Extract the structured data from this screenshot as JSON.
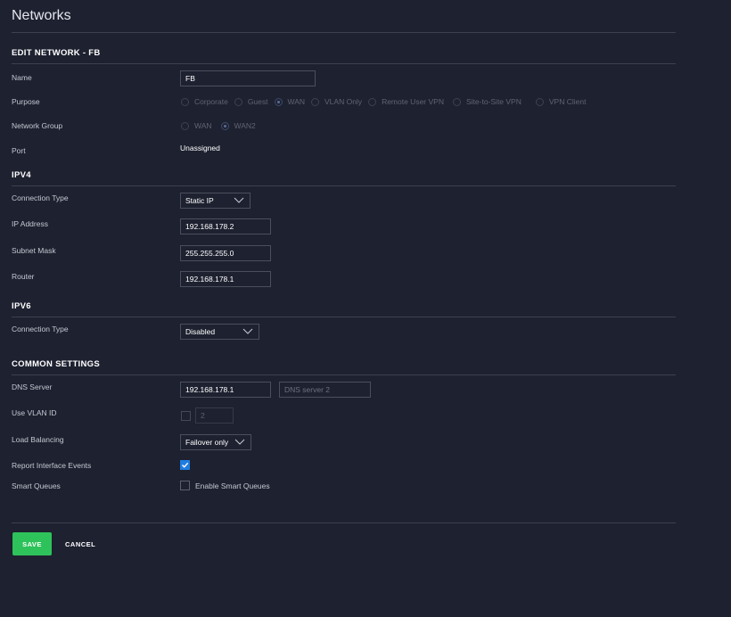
{
  "page": {
    "title": "Networks"
  },
  "edit": {
    "heading": "EDIT NETWORK - FB",
    "name_label": "Name",
    "name_value": "FB",
    "purpose_label": "Purpose",
    "purpose_options": [
      "Corporate",
      "Guest",
      "WAN",
      "VLAN Only",
      "Remote User VPN",
      "Site-to-Site VPN",
      "VPN Client"
    ],
    "purpose_selected": "WAN",
    "network_group_label": "Network Group",
    "network_group_options": [
      "WAN",
      "WAN2"
    ],
    "network_group_selected": "WAN2",
    "port_label": "Port",
    "port_value": "Unassigned"
  },
  "ipv4": {
    "heading": "IPV4",
    "connection_type_label": "Connection Type",
    "connection_type_value": "Static IP",
    "ip_label": "IP Address",
    "ip_value": "192.168.178.2",
    "subnet_label": "Subnet Mask",
    "subnet_value": "255.255.255.0",
    "router_label": "Router",
    "router_value": "192.168.178.1"
  },
  "ipv6": {
    "heading": "IPV6",
    "connection_type_label": "Connection Type",
    "connection_type_value": "Disabled"
  },
  "common": {
    "heading": "COMMON SETTINGS",
    "dns_label": "DNS Server",
    "dns1_value": "192.168.178.1",
    "dns2_placeholder": "DNS server 2",
    "vlan_label": "Use VLAN ID",
    "vlan_checked": false,
    "vlan_value": "2",
    "load_balancing_label": "Load Balancing",
    "load_balancing_value": "Failover only",
    "report_events_label": "Report Interface Events",
    "report_events_checked": true,
    "smart_queues_label": "Smart Queues",
    "smart_queues_checked": false,
    "smart_queues_text": "Enable Smart Queues"
  },
  "actions": {
    "save_label": "SAVE",
    "cancel_label": "CANCEL"
  },
  "colors": {
    "background": "#1e2130",
    "accent_green": "#2ec25a",
    "checkbox_blue": "#1e7de0"
  }
}
